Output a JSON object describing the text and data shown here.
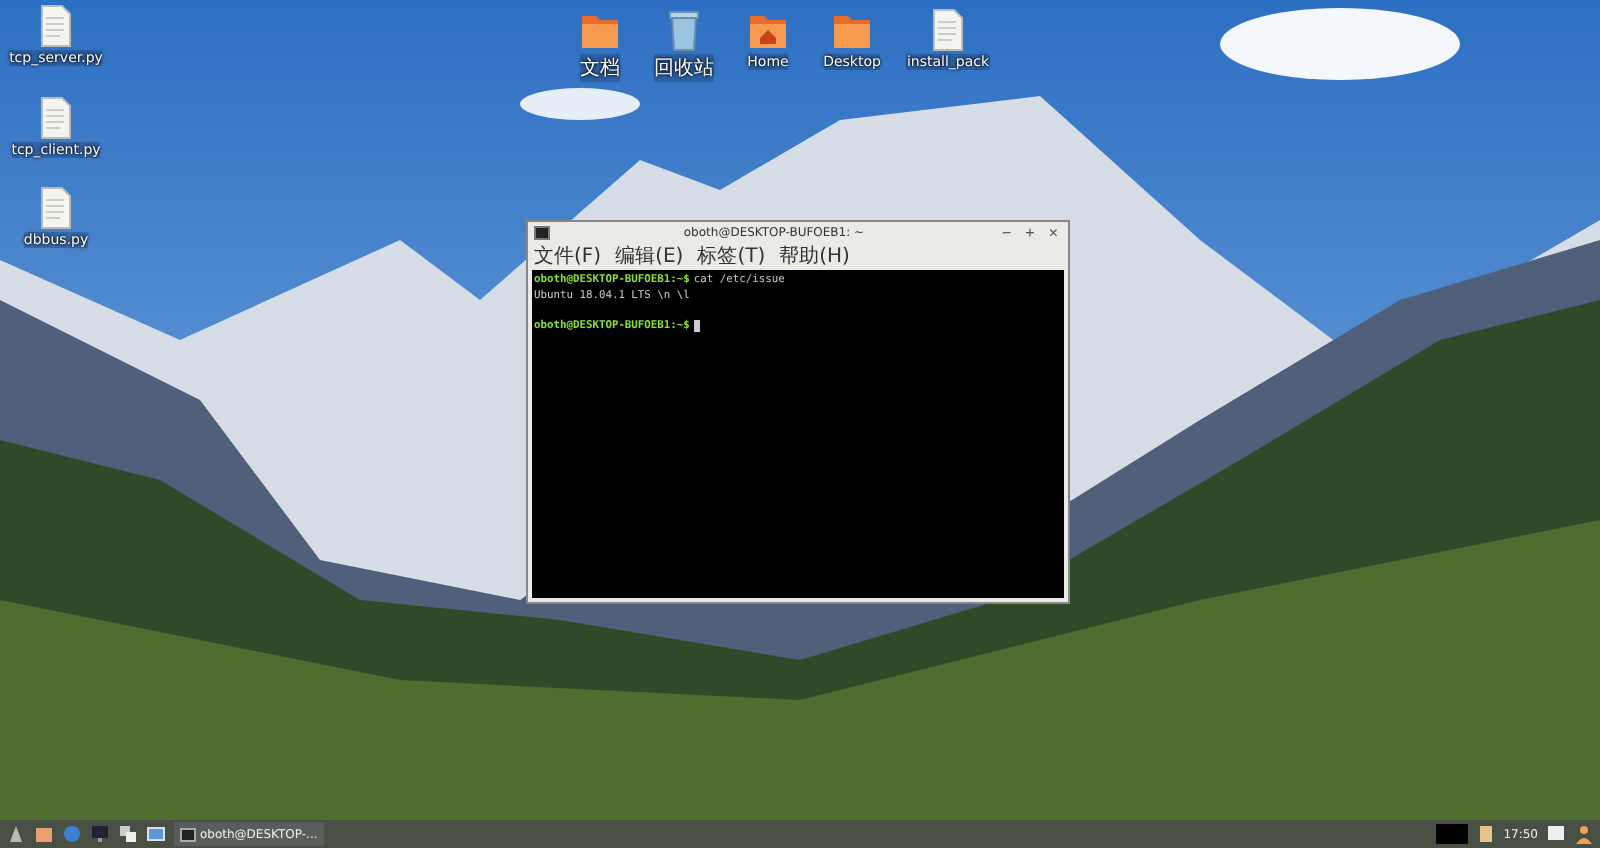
{
  "desktop_icons": [
    {
      "label": "tcp_server.py",
      "kind": "file"
    },
    {
      "label": "tcp_client.py",
      "kind": "file"
    },
    {
      "label": "dbbus.py",
      "kind": "file"
    },
    {
      "label": "文档",
      "kind": "folder"
    },
    {
      "label": "回收站",
      "kind": "trash"
    },
    {
      "label": "Home",
      "kind": "home"
    },
    {
      "label": "Desktop",
      "kind": "folder"
    },
    {
      "label": "install_pack",
      "kind": "file"
    }
  ],
  "window": {
    "title": "oboth@DESKTOP-BUFOEB1: ~",
    "controls": [
      "−",
      "+",
      "×"
    ],
    "menu": [
      "文件(F)",
      "编辑(E)",
      "标签(T)",
      "帮助(H)"
    ],
    "lines": [
      {
        "kind": "prompt",
        "prompt": "oboth@DESKTOP-BUFOEB1:~$",
        "command": "cat /etc/issue",
        "cursor": false
      },
      {
        "kind": "output",
        "text": "Ubuntu 18.04.1 LTS \\n \\l"
      },
      {
        "kind": "prompt",
        "prompt": "oboth@DESKTOP-BUFOEB1:~$",
        "cursor": true
      }
    ]
  },
  "taskbar": {
    "task_label": "oboth@DESKTOP-...",
    "clock": "17:50"
  }
}
